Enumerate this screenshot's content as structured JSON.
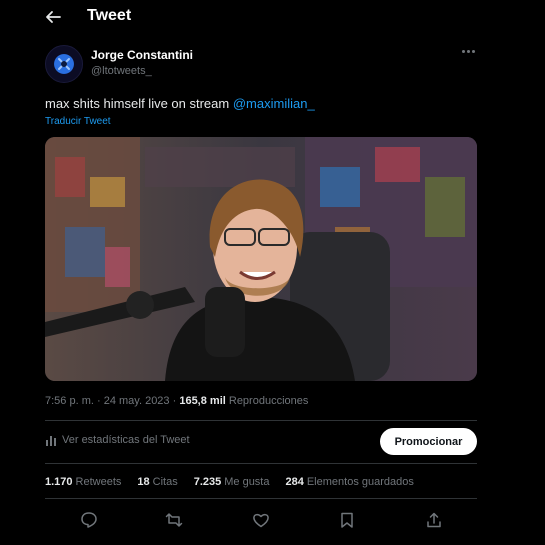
{
  "header": {
    "title": "Tweet"
  },
  "author": {
    "name": "Jorge Constantini",
    "handle": "@ltotweets_"
  },
  "tweet": {
    "text": "max shits himself live on stream ",
    "mention": "@maximilian_",
    "translate_label": "Traducir Tweet"
  },
  "meta": {
    "time": "7:56 p. m.",
    "date": "24 may. 2023",
    "views_count": "165,8 mil",
    "views_label": "Reproducciones"
  },
  "analytics": {
    "stats_label": "Ver estadísticas del Tweet",
    "promote_label": "Promocionar"
  },
  "counts": [
    {
      "value": "1.170",
      "label": "Retweets"
    },
    {
      "value": "18",
      "label": "Citas"
    },
    {
      "value": "7.235",
      "label": "Me gusta"
    },
    {
      "value": "284",
      "label": "Elementos guardados"
    }
  ],
  "icons": [
    "back-arrow-icon",
    "more-icon",
    "bar-chart-icon",
    "reply-icon",
    "retweet-icon",
    "like-icon",
    "bookmark-icon",
    "share-icon"
  ],
  "colors": {
    "background": "#000000",
    "accent": "#1d9bf0",
    "muted": "#71767b",
    "text": "#e7e9ea"
  }
}
